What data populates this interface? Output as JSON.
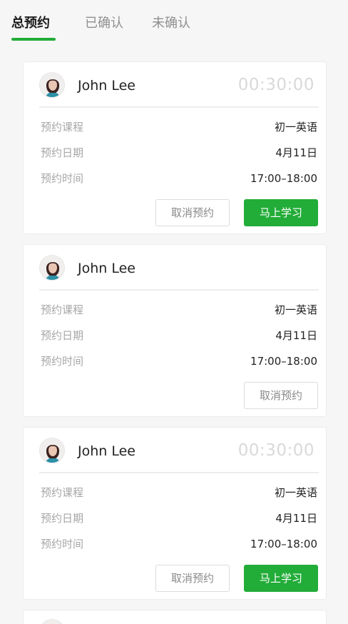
{
  "tabs": [
    {
      "label": "总预约",
      "active": true
    },
    {
      "label": "已确认",
      "active": false
    },
    {
      "label": "未确认",
      "active": false
    }
  ],
  "colors": {
    "accent": "#22ac38",
    "muted": "#a7a7a7",
    "timer": "#d9d9d9"
  },
  "cards": [
    {
      "teacher": "John Lee",
      "timer": "00:30:00",
      "course_label": "预约课程",
      "course": "初一英语",
      "date_label": "预约日期",
      "date": "4月11日",
      "time_label": "预约时间",
      "time": "17:00–18:00",
      "cancel_label": "取消预约",
      "study_label": "马上学习"
    },
    {
      "teacher": "John Lee",
      "course_label": "预约课程",
      "course": "初一英语",
      "date_label": "预约日期",
      "date": "4月11日",
      "time_label": "预约时间",
      "time": "17:00–18:00",
      "cancel_label": "取消预约"
    },
    {
      "teacher": "John Lee",
      "timer": "00:30:00",
      "course_label": "预约课程",
      "course": "初一英语",
      "date_label": "预约日期",
      "date": "4月11日",
      "time_label": "预约时间",
      "time": "17:00–18:00",
      "cancel_label": "取消预约",
      "study_label": "马上学习"
    }
  ]
}
